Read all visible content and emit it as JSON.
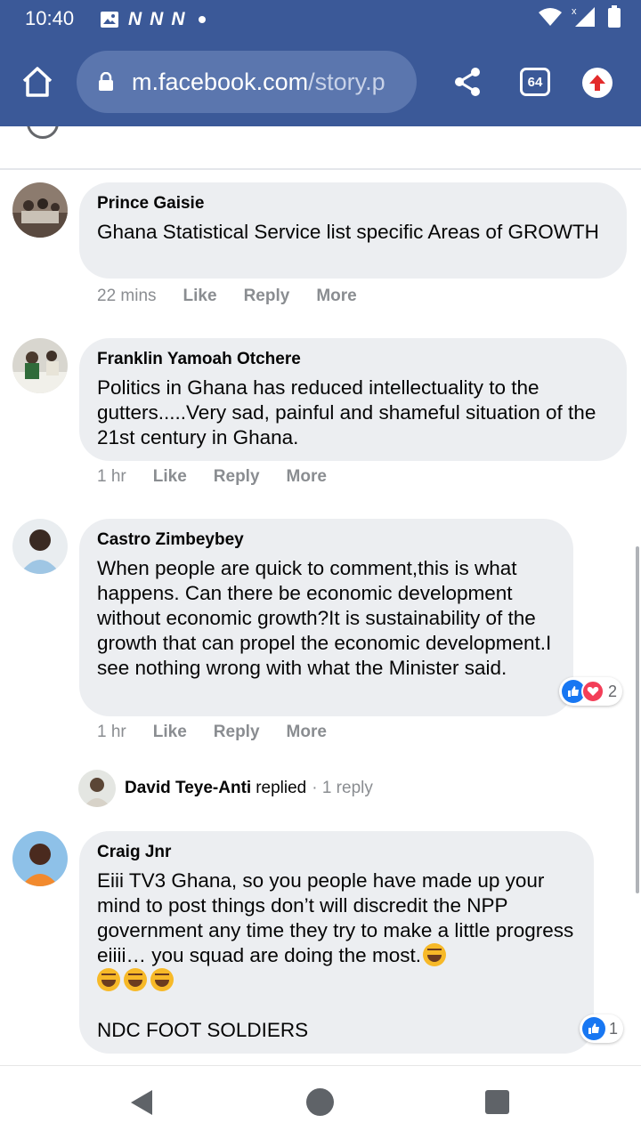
{
  "status_bar": {
    "time": "10:40",
    "notifications": [
      "N",
      "N",
      "N"
    ],
    "icons": [
      "image-icon",
      "wifi-icon",
      "signal-icon",
      "battery-icon"
    ]
  },
  "browser": {
    "url_domain": "m.facebook.com",
    "url_path": "/story.p",
    "tab_count": "64",
    "colors": {
      "toolbar": "#3b5998",
      "urlbar": "#5b76ae"
    }
  },
  "comments": [
    {
      "author": "Prince Gaisie",
      "text": "Ghana Statistical Service list specific Areas of GROWTH",
      "time": "22 mins",
      "like": "Like",
      "reply": "Reply",
      "more": "More"
    },
    {
      "author": "Franklin Yamoah Otchere",
      "text": "Politics in Ghana has reduced intellectuality to the gutters.....Very sad, painful and shameful situation of the 21st century in Ghana.",
      "time": "1 hr",
      "like": "Like",
      "reply": "Reply",
      "more": "More"
    },
    {
      "author": "Castro Zimbeybey",
      "text": "When people are quick to comment,this is what happens. Can there be economic development without economic growth?It is sustainability of the growth that can propel the economic development.I see nothing wrong with what the Minister said.",
      "time": "1 hr",
      "like": "Like",
      "reply": "Reply",
      "more": "More",
      "reaction_count": "2"
    },
    {
      "author": "Craig Jnr",
      "text": "Eiii TV3 Ghana, so you people have made up your mind to post things don’t will discredit the NPP government any time they try to make a little progress eiiii… you squad are doing the most.",
      "text_tail": "NDC FOOT SOLDIERS",
      "reaction_count": "1"
    }
  ],
  "reply_summary": {
    "name": "David Teye-Anti",
    "verb": "replied",
    "count": "· 1 reply"
  }
}
